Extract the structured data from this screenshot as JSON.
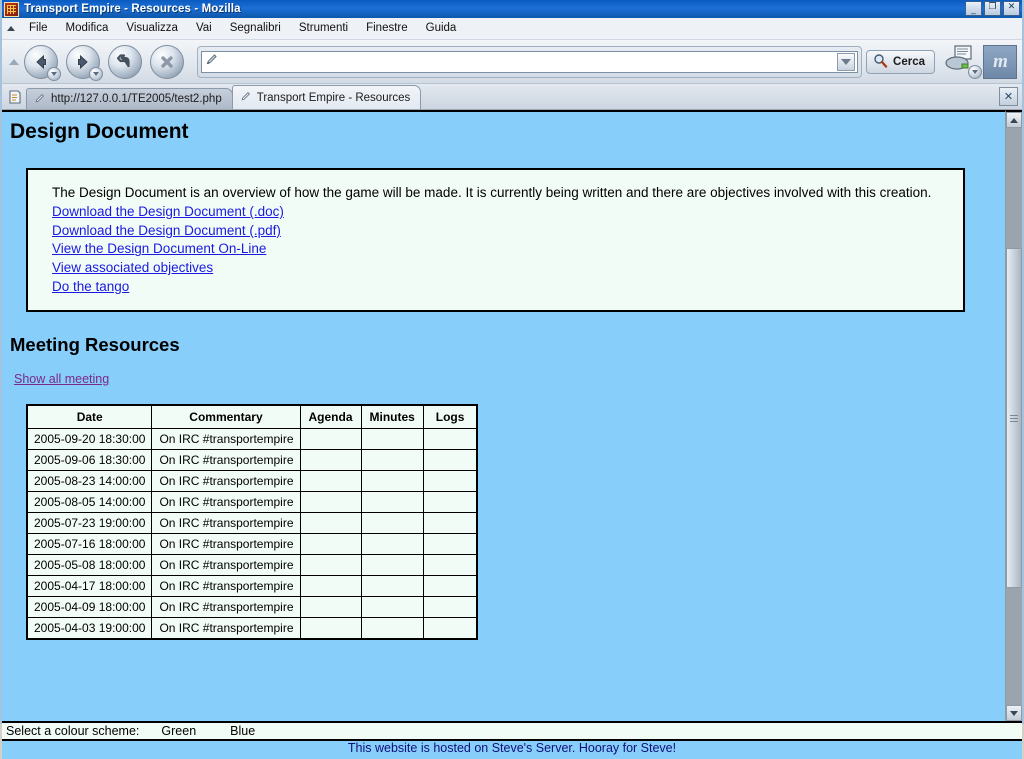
{
  "window": {
    "title": "Transport Empire - Resources - Mozilla",
    "app_icon": "transport-empire-icon",
    "minimize_label": "_",
    "restore_label": "❐",
    "close_label": "✕"
  },
  "menu": {
    "items": [
      {
        "label": "File"
      },
      {
        "label": "Modifica"
      },
      {
        "label": "Visualizza"
      },
      {
        "label": "Vai"
      },
      {
        "label": "Segnalibri"
      },
      {
        "label": "Strumenti"
      },
      {
        "label": "Finestre"
      },
      {
        "label": "Guida"
      }
    ]
  },
  "toolbar": {
    "back_icon": "back-arrow-icon",
    "forward_icon": "forward-arrow-icon",
    "reload_icon": "reload-icon",
    "stop_icon": "stop-icon",
    "url_value": "",
    "url_placeholder": "",
    "url_icon": "pencil-icon",
    "url_dropdown_icon": "chevron-down-icon",
    "search_label": "Cerca",
    "search_icon": "magnifier-icon",
    "print_icon": "print-icon",
    "mozilla_logo": "mozilla-logo",
    "mozilla_letter": "m"
  },
  "tabs": {
    "list_icon": "tab-list-icon",
    "items": [
      {
        "label": "http://127.0.0.1/TE2005/test2.php",
        "icon": "page-icon",
        "active": false
      },
      {
        "label": "Transport Empire - Resources",
        "icon": "page-icon",
        "active": true
      }
    ],
    "close_label": "✕"
  },
  "page": {
    "title": "Design Document",
    "panel": {
      "paragraph": "The Design Document is an overview of how the game will be made. It is currently being written and there are objectives involved with this creation.",
      "links": [
        "Download the Design Document (.doc)",
        "Download the Design Document (.pdf)",
        "View the Design Document On-Line",
        "View associated objectives",
        "Do the tango"
      ]
    },
    "section_title": "Meeting Resources",
    "show_all_link": "Show all meeting",
    "table": {
      "headers": [
        "Date",
        "Commentary",
        "Agenda",
        "Minutes",
        "Logs"
      ],
      "rows": [
        {
          "date": "2005-09-20 18:30:00",
          "commentary": "On IRC #transportempire",
          "agenda": "",
          "minutes": "",
          "logs": ""
        },
        {
          "date": "2005-09-06 18:30:00",
          "commentary": "On IRC #transportempire",
          "agenda": "",
          "minutes": "",
          "logs": ""
        },
        {
          "date": "2005-08-23 14:00:00",
          "commentary": "On IRC #transportempire",
          "agenda": "",
          "minutes": "",
          "logs": ""
        },
        {
          "date": "2005-08-05 14:00:00",
          "commentary": "On IRC #transportempire",
          "agenda": "",
          "minutes": "",
          "logs": ""
        },
        {
          "date": "2005-07-23 19:00:00",
          "commentary": "On IRC #transportempire",
          "agenda": "",
          "minutes": "",
          "logs": ""
        },
        {
          "date": "2005-07-16 18:00:00",
          "commentary": "On IRC #transportempire",
          "agenda": "",
          "minutes": "",
          "logs": ""
        },
        {
          "date": "2005-05-08 18:00:00",
          "commentary": "On IRC #transportempire",
          "agenda": "",
          "minutes": "",
          "logs": ""
        },
        {
          "date": "2005-04-17 18:00:00",
          "commentary": "On IRC #transportempire",
          "agenda": "",
          "minutes": "",
          "logs": ""
        },
        {
          "date": "2005-04-09 18:00:00",
          "commentary": "On IRC #transportempire",
          "agenda": "",
          "minutes": "",
          "logs": ""
        },
        {
          "date": "2005-04-03 19:00:00",
          "commentary": "On IRC #transportempire",
          "agenda": "",
          "minutes": "",
          "logs": ""
        }
      ]
    },
    "scheme": {
      "label": "Select a colour scheme:",
      "options": [
        "Green",
        "Blue"
      ]
    },
    "footer": "This website is hosted on Steve's Server. Hooray for Steve!"
  },
  "scrollbar": {
    "up_icon": "scroll-up-icon",
    "down_icon": "scroll-down-icon"
  },
  "colors": {
    "page_background": "#87cefa",
    "panel_background": "#f2fcf6",
    "link": "#1a1ae0",
    "visited_link": "#7a2a8a",
    "footer_text": "#10107a",
    "titlebar": "#0d56ad"
  }
}
